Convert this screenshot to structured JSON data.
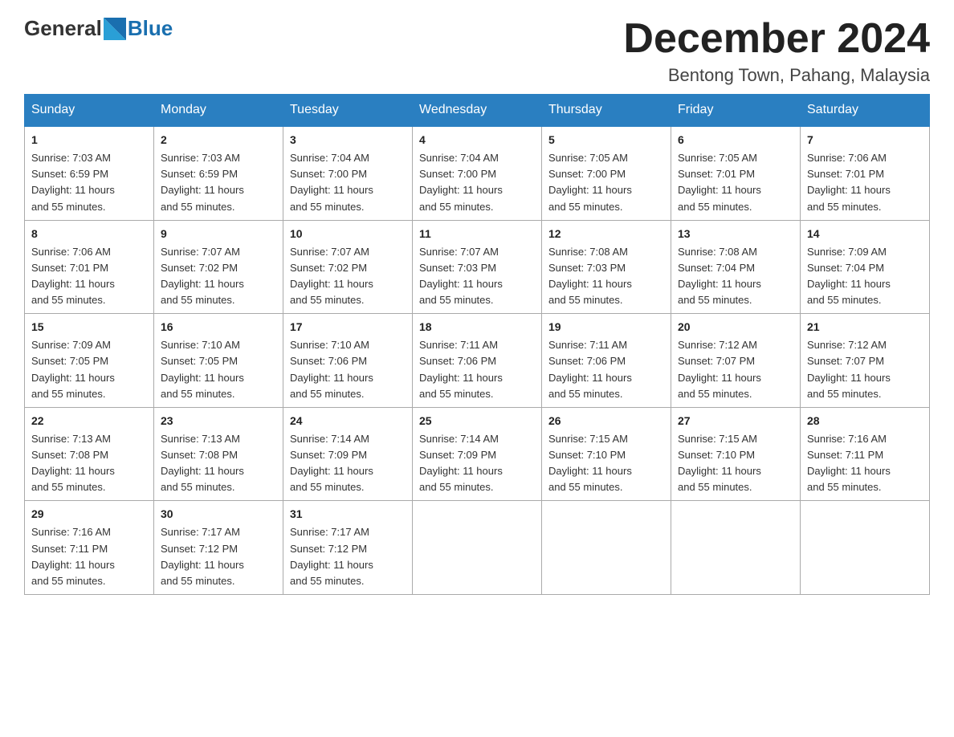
{
  "header": {
    "logo_general": "General",
    "logo_blue": "Blue",
    "month_title": "December 2024",
    "location": "Bentong Town, Pahang, Malaysia"
  },
  "days_of_week": [
    "Sunday",
    "Monday",
    "Tuesday",
    "Wednesday",
    "Thursday",
    "Friday",
    "Saturday"
  ],
  "weeks": [
    [
      {
        "day": "1",
        "sunrise": "7:03 AM",
        "sunset": "6:59 PM",
        "daylight": "11 hours and 55 minutes."
      },
      {
        "day": "2",
        "sunrise": "7:03 AM",
        "sunset": "6:59 PM",
        "daylight": "11 hours and 55 minutes."
      },
      {
        "day": "3",
        "sunrise": "7:04 AM",
        "sunset": "7:00 PM",
        "daylight": "11 hours and 55 minutes."
      },
      {
        "day": "4",
        "sunrise": "7:04 AM",
        "sunset": "7:00 PM",
        "daylight": "11 hours and 55 minutes."
      },
      {
        "day": "5",
        "sunrise": "7:05 AM",
        "sunset": "7:00 PM",
        "daylight": "11 hours and 55 minutes."
      },
      {
        "day": "6",
        "sunrise": "7:05 AM",
        "sunset": "7:01 PM",
        "daylight": "11 hours and 55 minutes."
      },
      {
        "day": "7",
        "sunrise": "7:06 AM",
        "sunset": "7:01 PM",
        "daylight": "11 hours and 55 minutes."
      }
    ],
    [
      {
        "day": "8",
        "sunrise": "7:06 AM",
        "sunset": "7:01 PM",
        "daylight": "11 hours and 55 minutes."
      },
      {
        "day": "9",
        "sunrise": "7:07 AM",
        "sunset": "7:02 PM",
        "daylight": "11 hours and 55 minutes."
      },
      {
        "day": "10",
        "sunrise": "7:07 AM",
        "sunset": "7:02 PM",
        "daylight": "11 hours and 55 minutes."
      },
      {
        "day": "11",
        "sunrise": "7:07 AM",
        "sunset": "7:03 PM",
        "daylight": "11 hours and 55 minutes."
      },
      {
        "day": "12",
        "sunrise": "7:08 AM",
        "sunset": "7:03 PM",
        "daylight": "11 hours and 55 minutes."
      },
      {
        "day": "13",
        "sunrise": "7:08 AM",
        "sunset": "7:04 PM",
        "daylight": "11 hours and 55 minutes."
      },
      {
        "day": "14",
        "sunrise": "7:09 AM",
        "sunset": "7:04 PM",
        "daylight": "11 hours and 55 minutes."
      }
    ],
    [
      {
        "day": "15",
        "sunrise": "7:09 AM",
        "sunset": "7:05 PM",
        "daylight": "11 hours and 55 minutes."
      },
      {
        "day": "16",
        "sunrise": "7:10 AM",
        "sunset": "7:05 PM",
        "daylight": "11 hours and 55 minutes."
      },
      {
        "day": "17",
        "sunrise": "7:10 AM",
        "sunset": "7:06 PM",
        "daylight": "11 hours and 55 minutes."
      },
      {
        "day": "18",
        "sunrise": "7:11 AM",
        "sunset": "7:06 PM",
        "daylight": "11 hours and 55 minutes."
      },
      {
        "day": "19",
        "sunrise": "7:11 AM",
        "sunset": "7:06 PM",
        "daylight": "11 hours and 55 minutes."
      },
      {
        "day": "20",
        "sunrise": "7:12 AM",
        "sunset": "7:07 PM",
        "daylight": "11 hours and 55 minutes."
      },
      {
        "day": "21",
        "sunrise": "7:12 AM",
        "sunset": "7:07 PM",
        "daylight": "11 hours and 55 minutes."
      }
    ],
    [
      {
        "day": "22",
        "sunrise": "7:13 AM",
        "sunset": "7:08 PM",
        "daylight": "11 hours and 55 minutes."
      },
      {
        "day": "23",
        "sunrise": "7:13 AM",
        "sunset": "7:08 PM",
        "daylight": "11 hours and 55 minutes."
      },
      {
        "day": "24",
        "sunrise": "7:14 AM",
        "sunset": "7:09 PM",
        "daylight": "11 hours and 55 minutes."
      },
      {
        "day": "25",
        "sunrise": "7:14 AM",
        "sunset": "7:09 PM",
        "daylight": "11 hours and 55 minutes."
      },
      {
        "day": "26",
        "sunrise": "7:15 AM",
        "sunset": "7:10 PM",
        "daylight": "11 hours and 55 minutes."
      },
      {
        "day": "27",
        "sunrise": "7:15 AM",
        "sunset": "7:10 PM",
        "daylight": "11 hours and 55 minutes."
      },
      {
        "day": "28",
        "sunrise": "7:16 AM",
        "sunset": "7:11 PM",
        "daylight": "11 hours and 55 minutes."
      }
    ],
    [
      {
        "day": "29",
        "sunrise": "7:16 AM",
        "sunset": "7:11 PM",
        "daylight": "11 hours and 55 minutes."
      },
      {
        "day": "30",
        "sunrise": "7:17 AM",
        "sunset": "7:12 PM",
        "daylight": "11 hours and 55 minutes."
      },
      {
        "day": "31",
        "sunrise": "7:17 AM",
        "sunset": "7:12 PM",
        "daylight": "11 hours and 55 minutes."
      },
      null,
      null,
      null,
      null
    ]
  ],
  "labels": {
    "sunrise": "Sunrise:",
    "sunset": "Sunset:",
    "daylight": "Daylight:"
  }
}
